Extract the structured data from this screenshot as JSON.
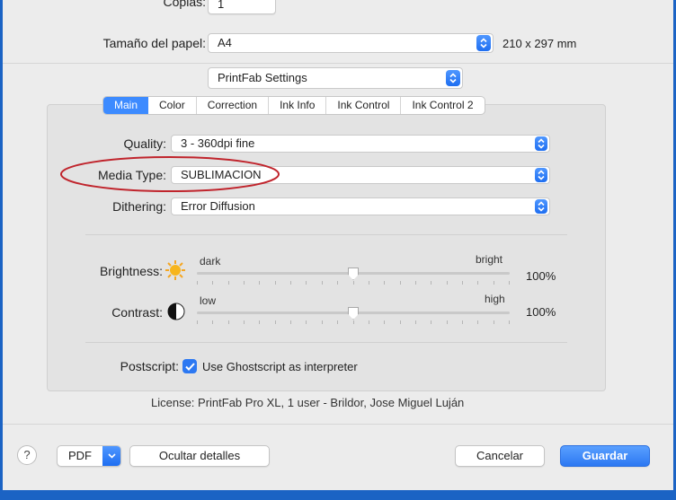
{
  "copies": {
    "label": "Copias:",
    "value": "1"
  },
  "paper_size": {
    "label": "Tamaño del papel:",
    "value": "A4",
    "dimensions": "210 x 297 mm"
  },
  "settings_panel": {
    "value": "PrintFab Settings"
  },
  "tabs": [
    {
      "label": "Main",
      "active": true
    },
    {
      "label": "Color",
      "active": false
    },
    {
      "label": "Correction",
      "active": false
    },
    {
      "label": "Ink Info",
      "active": false
    },
    {
      "label": "Ink Control",
      "active": false
    },
    {
      "label": "Ink Control 2",
      "active": false
    }
  ],
  "quality": {
    "label": "Quality:",
    "value": "3 - 360dpi fine"
  },
  "media_type": {
    "label": "Media Type:",
    "value": "SUBLIMACION"
  },
  "dithering": {
    "label": "Dithering:",
    "value": "Error Diffusion"
  },
  "brightness": {
    "label": "Brightness:",
    "min_label": "dark",
    "max_label": "bright",
    "value_text": "100%",
    "level": 0.5
  },
  "contrast": {
    "label": "Contrast:",
    "min_label": "low",
    "max_label": "high",
    "value_text": "100%",
    "level": 0.5
  },
  "postscript": {
    "label": "Postscript:",
    "checkbox_label": "Use Ghostscript as interpreter",
    "checked": true
  },
  "license": "License: PrintFab Pro XL, 1 user - Brildor, Jose Miguel Luján",
  "footer": {
    "help_label": "?",
    "pdf_label": "PDF",
    "hide_details_label": "Ocultar detalles",
    "cancel_label": "Cancelar",
    "save_label": "Guardar"
  },
  "colors": {
    "accent": "#2c78f2",
    "highlight_ellipse": "#c0242c",
    "window_frame": "#1b63c4"
  }
}
